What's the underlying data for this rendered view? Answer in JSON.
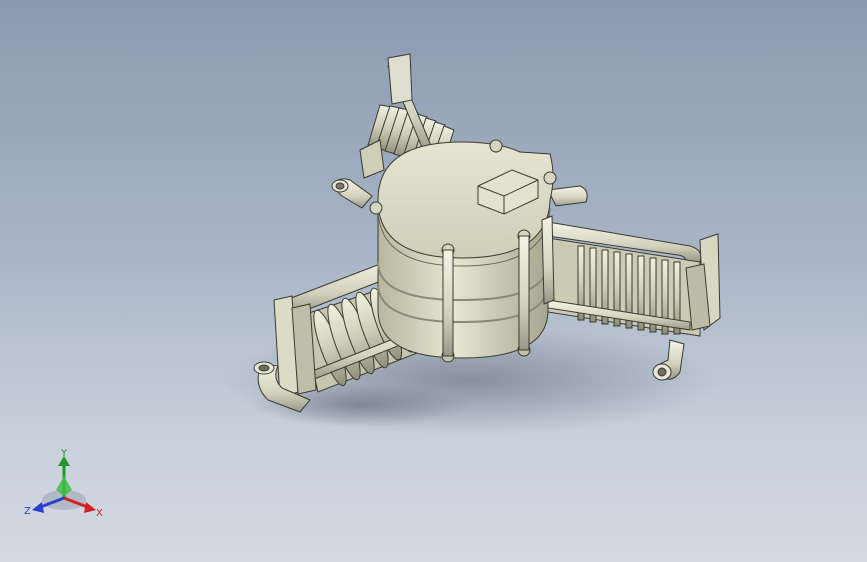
{
  "viewport": {
    "background_top": "#8b9ab1",
    "background_bottom": "#d4dae3"
  },
  "model": {
    "part_color": "#d9d9c2",
    "part_shadow": "#9c9c87",
    "edge_color": "#3a3a32"
  },
  "triad": {
    "x_label": "X",
    "y_label": "Y",
    "z_label": "Z",
    "x_color": "#d42020",
    "y_color": "#1f9a2a",
    "z_color": "#2a3fd0"
  }
}
